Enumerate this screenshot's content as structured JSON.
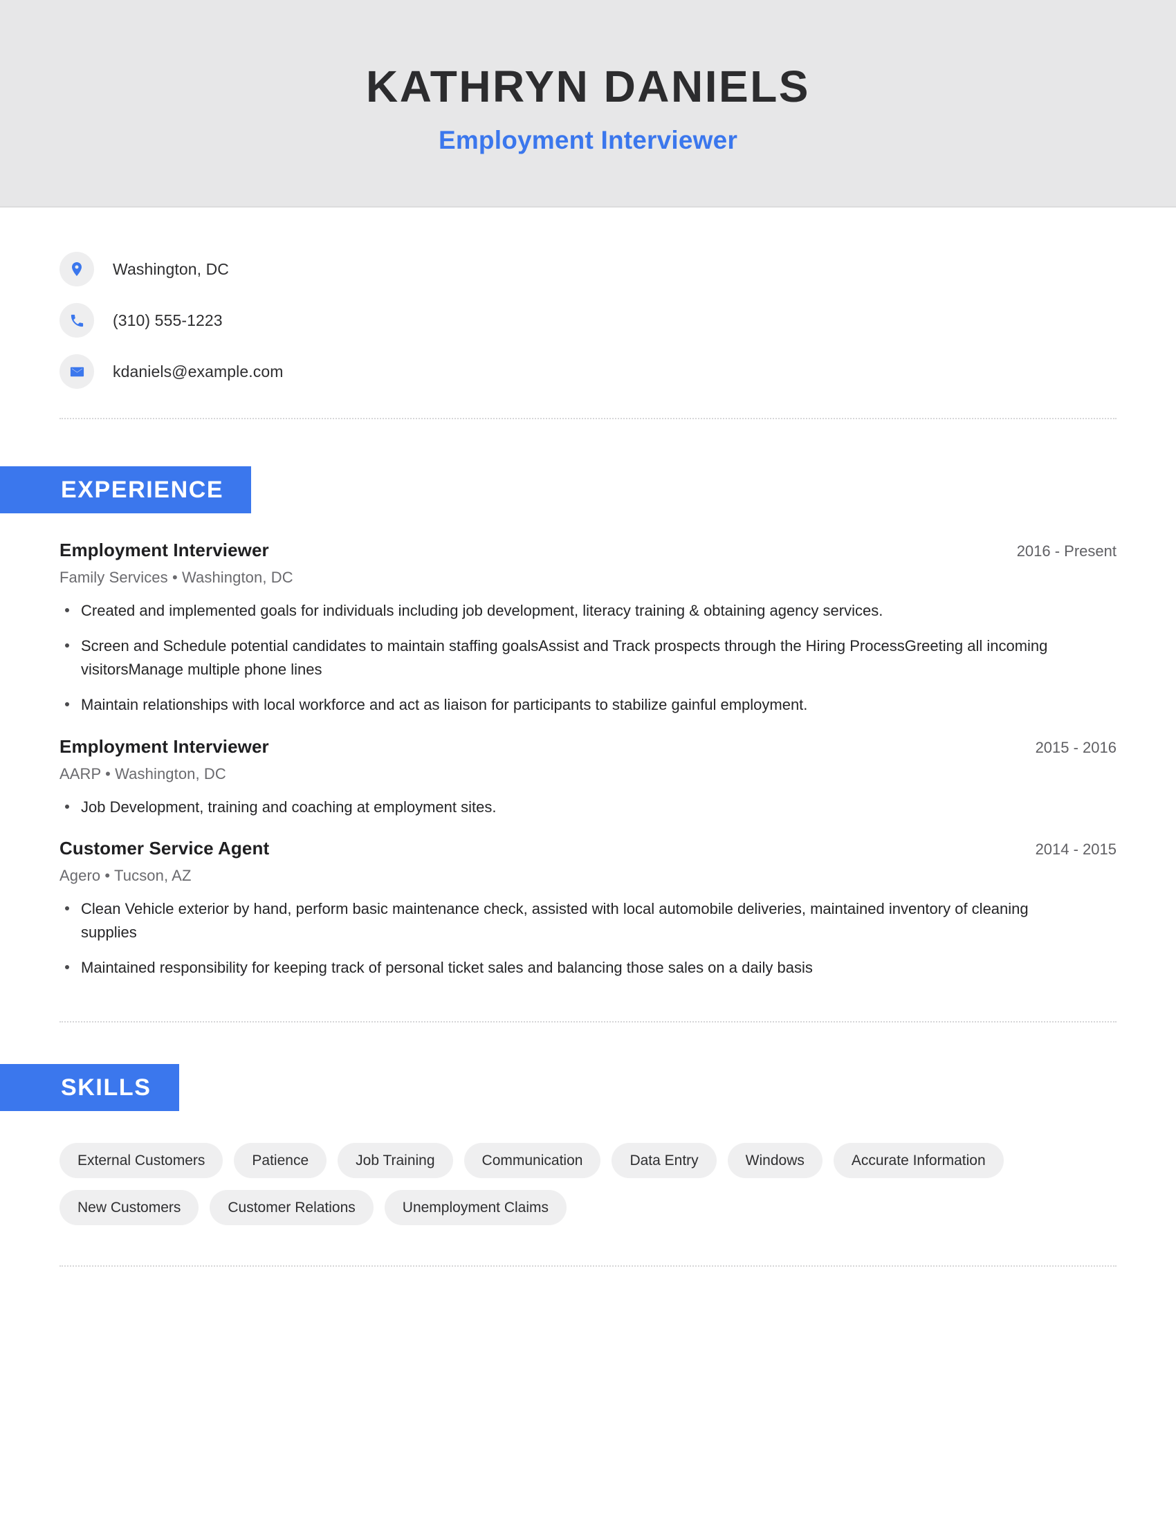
{
  "theme": {
    "accent": "#3b77ed",
    "header_bg": "#e7e7e8",
    "tag_bg": "#efeff0",
    "text": "#252527",
    "muted": "#6a6a6e"
  },
  "header": {
    "name": "KATHRYN DANIELS",
    "job_title": "Employment Interviewer"
  },
  "contact": {
    "items": [
      {
        "icon": "location-pin-icon",
        "value": "Washington, DC"
      },
      {
        "icon": "phone-icon",
        "value": "(310) 555-1223"
      },
      {
        "icon": "email-icon",
        "value": "kdaniels@example.com"
      }
    ]
  },
  "experience": {
    "heading": "EXPERIENCE",
    "jobs": [
      {
        "title": "Employment Interviewer",
        "dates": "2016 - Present",
        "company": "Family Services",
        "location": "Washington, DC",
        "meta": "Family Services  •  Washington, DC",
        "bullets": [
          "Created and implemented goals for individuals including job development, literacy training & obtaining agency services.",
          "Screen and Schedule potential candidates to maintain staffing goalsAssist and Track prospects through the Hiring ProcessGreeting all incoming visitorsManage multiple phone lines",
          "Maintain relationships with local workforce and act as liaison for participants to stabilize gainful employment."
        ]
      },
      {
        "title": "Employment Interviewer",
        "dates": "2015 - 2016",
        "company": "AARP",
        "location": "Washington, DC",
        "meta": "AARP  •  Washington, DC",
        "bullets": [
          "Job Development, training and coaching at employment sites."
        ]
      },
      {
        "title": "Customer Service Agent",
        "dates": "2014 - 2015",
        "company": "Agero",
        "location": "Tucson, AZ",
        "meta": "Agero  •  Tucson, AZ",
        "bullets": [
          "Clean Vehicle exterior by hand, perform basic maintenance check, assisted with local automobile deliveries, maintained inventory of cleaning supplies",
          "Maintained responsibility for keeping track of personal ticket sales and balancing those sales on a daily basis"
        ]
      }
    ]
  },
  "skills": {
    "heading": "SKILLS",
    "tags": [
      "External Customers",
      "Patience",
      "Job Training",
      "Communication",
      "Data Entry",
      "Windows",
      "Accurate Information",
      "New Customers",
      "Customer Relations",
      "Unemployment Claims"
    ]
  }
}
